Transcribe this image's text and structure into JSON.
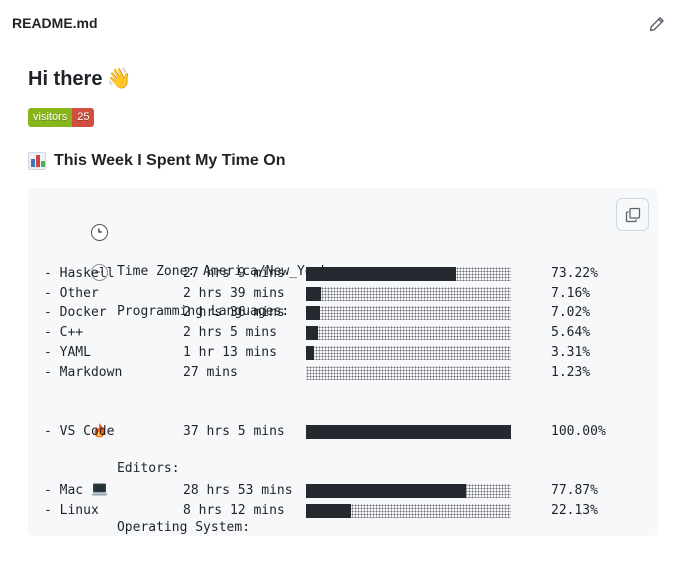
{
  "file": {
    "name": "README.md"
  },
  "readme": {
    "title": "Hi there",
    "title_emoji": "👋",
    "badge": {
      "label": "visitors",
      "count": "25",
      "label_color": "#87b51b",
      "count_color": "#d14f3f"
    },
    "section_title": "This Week I Spent My Time On"
  },
  "stats": {
    "timezone_label": "Time Zone: America/New_York",
    "languages_label": "Programming Languages:",
    "languages": [
      {
        "name": "- Haskell",
        "time": "27 hrs 9 mins",
        "percent": "73.22%",
        "fraction": 0.7322
      },
      {
        "name": "- Other",
        "time": "2 hrs 39 mins",
        "percent": "7.16%",
        "fraction": 0.0716
      },
      {
        "name": "- Docker",
        "time": "2 hrs 36 mins",
        "percent": "7.02%",
        "fraction": 0.0702
      },
      {
        "name": "- C++",
        "time": "2 hrs 5 mins",
        "percent": "5.64%",
        "fraction": 0.0564
      },
      {
        "name": "- YAML",
        "time": "1 hr 13 mins",
        "percent": "3.31%",
        "fraction": 0.0331
      },
      {
        "name": "- Markdown",
        "time": "27 mins",
        "percent": "1.23%",
        "fraction": 0.0123
      }
    ],
    "editors_label": "Editors:",
    "editors": [
      {
        "name": "- VS Code",
        "time": "37 hrs 5 mins",
        "percent": "100.00%",
        "fraction": 1.0
      }
    ],
    "os_label": "Operating System:",
    "os": [
      {
        "name": "- Mac",
        "time": "28 hrs 53 mins",
        "percent": "77.87%",
        "fraction": 0.7787
      },
      {
        "name": "- Linux",
        "time": "8 hrs 12 mins",
        "percent": "22.13%",
        "fraction": 0.2213
      }
    ]
  },
  "icons": {
    "edit": "pencil-icon",
    "copy": "copy-icon",
    "clock": "clock-icon",
    "speech": "speech-bubble-icon",
    "fire": "fire-icon",
    "laptop": "laptop-icon",
    "chart": "bar-chart-icon"
  }
}
